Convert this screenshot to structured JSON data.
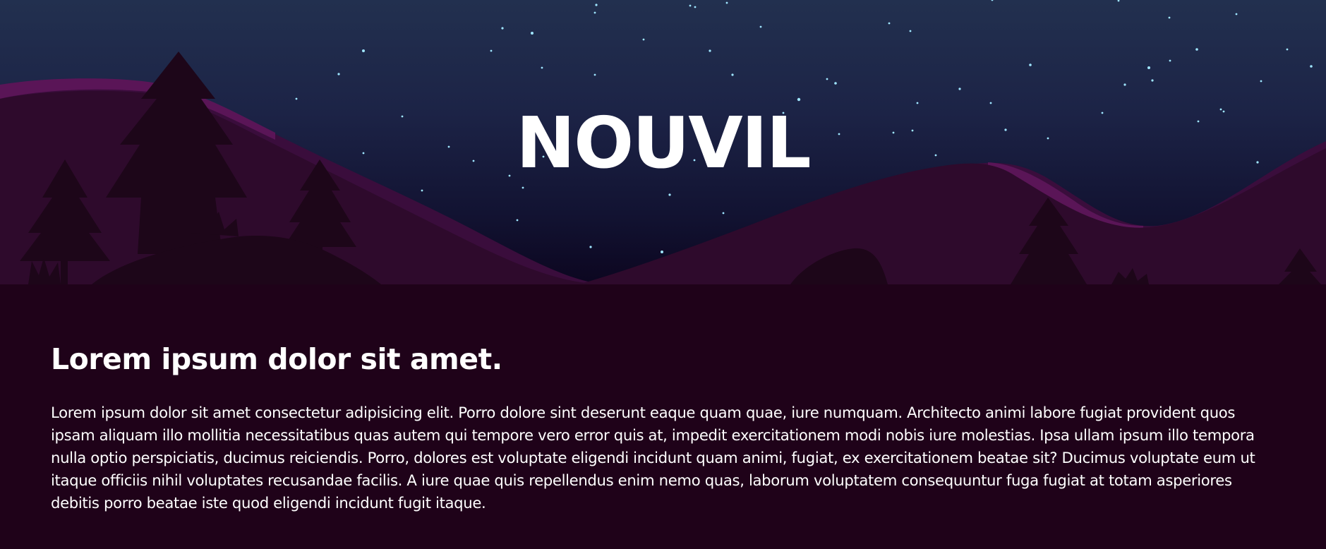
{
  "hero": {
    "title": "NOUVIL"
  },
  "content": {
    "heading": "Lorem ipsum dolor sit amet.",
    "body": "Lorem ipsum dolor sit amet consectetur adipisicing elit. Porro dolore sint deserunt eaque quam quae, iure numquam. Architecto animi labore fugiat provident quos ipsam aliquam illo mollitia necessitatibus quas autem qui tempore vero error quis at, impedit exercitationem modi nobis iure molestias. Ipsa ullam ipsum illo tempora nulla optio perspiciatis, ducimus reiciendis. Porro, dolores est voluptate eligendi incidunt quam animi, fugiat, ex exercitationem beatae sit? Ducimus voluptate eum ut itaque officiis nihil voluptates recusandae facilis. A iure quae quis repellendus enim nemo quas, laborum voluptatem consequuntur fuga fugiat at totam asperiores debitis porro beatae iste quod eligendi incidunt fugit itaque."
  },
  "colors": {
    "sky_top": "#22304f",
    "sky_bottom": "#0d0722",
    "hill": "#2e0a2c",
    "hill_highlight": "#5a1557",
    "tree": "#1d0619",
    "page_background": "#1f0219",
    "text": "#ffffff",
    "star": "#9fe6ff"
  }
}
